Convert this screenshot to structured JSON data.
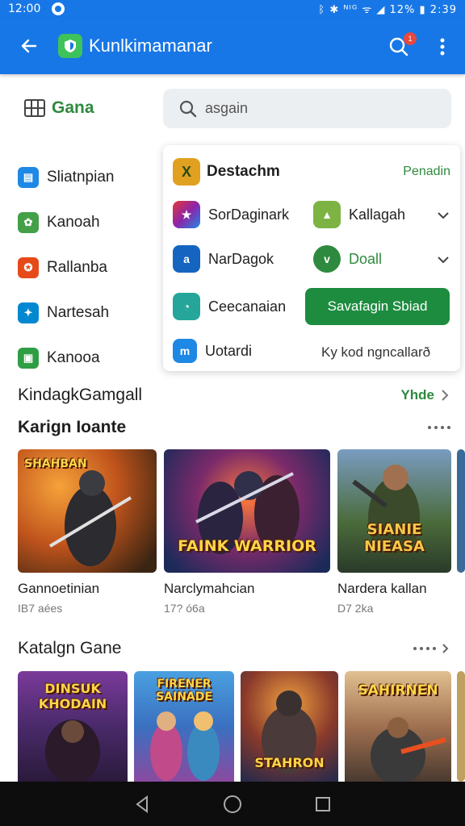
{
  "status_bar": {
    "time": "12:00",
    "right": "ᛒ ✱ ᴺᴵᴳ ᯤ ◢ 12% ▮ 2:39"
  },
  "app_bar": {
    "title": "Kunlkimamanar",
    "badge": "1"
  },
  "section": {
    "label": "Gana"
  },
  "search": {
    "placeholder": "asgain"
  },
  "sidebar": {
    "items": [
      {
        "label": "Sliatnpian",
        "color": "#1e88e5"
      },
      {
        "label": "Kanoah",
        "color": "#43a047"
      },
      {
        "label": "Rallanba",
        "color": "#e64a19"
      },
      {
        "label": "Nartesah",
        "color": "#0288d1"
      },
      {
        "label": "Kanooa",
        "color": "#2e9e45"
      }
    ]
  },
  "dropdown": {
    "title": "Destachm",
    "action": "Penadin",
    "items": [
      {
        "label": "SorDaginark",
        "color": "#8e24aa"
      },
      {
        "label": "Kallagah",
        "color": "#7cb342"
      },
      {
        "label": "NarDagok",
        "color": "#1565c0"
      },
      {
        "label": "Doall",
        "color": "#2e8a3e"
      },
      {
        "label": "Ceecanaian",
        "color": "#26a69a"
      },
      {
        "label": "Uotardi",
        "color": "#1e88e5"
      }
    ],
    "button_label": "Savafagin Sbiad",
    "footer_text": "Ky kod ngncallarð"
  },
  "row1": {
    "title": "KindagkGamgall",
    "more_label": "Yhde"
  },
  "row2": {
    "title": "Karign Ioante",
    "cards": [
      {
        "name": "Gannoetinian",
        "meta": "IB7 aées",
        "art": "SHAHBAN"
      },
      {
        "name": "Narclymahcian",
        "meta": "17? ó6a",
        "art": "FAINK WARRIOR"
      },
      {
        "name": "Nardera kallan",
        "meta": "D7 2ka",
        "art": "SIANIE NIEASA"
      }
    ]
  },
  "row3": {
    "title": "Katalgn Gane",
    "cards": [
      {
        "art": "DINSUK KHODAIN"
      },
      {
        "art": "FIRENER SAINADE"
      },
      {
        "art": "STAHRON"
      },
      {
        "art": "SAHIRNEN"
      }
    ]
  },
  "colors": {
    "primary": "#1877e6",
    "accent_green": "#2e8a3e",
    "button_green": "#1d8c3f"
  }
}
